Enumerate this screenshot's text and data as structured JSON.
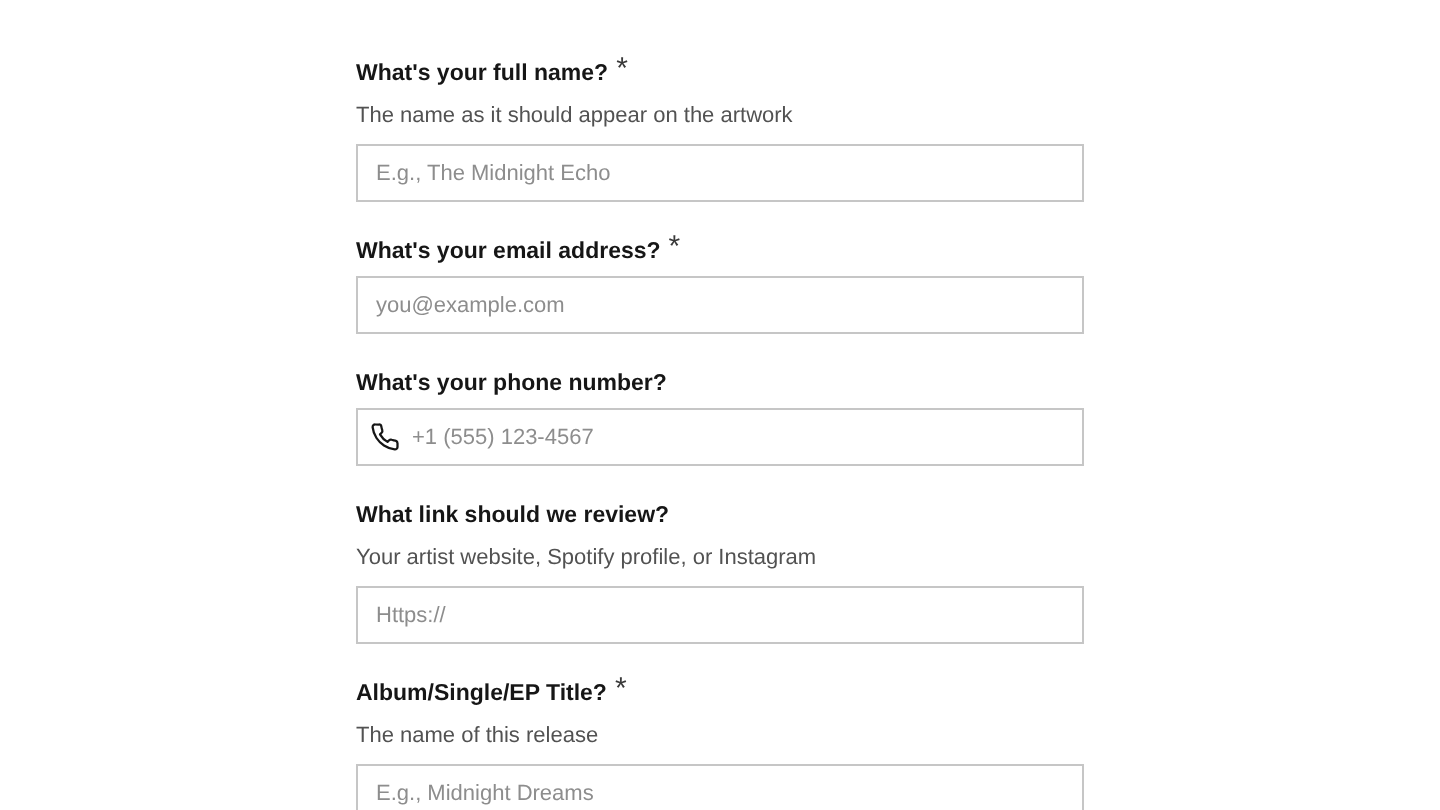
{
  "fields": [
    {
      "label": "What's your full name?",
      "required_mark": "*",
      "help": "The name as it should appear on the artwork",
      "placeholder": "E.g., The Midnight Echo"
    },
    {
      "label": "What's your email address?",
      "required_mark": "*",
      "placeholder": "you@example.com"
    },
    {
      "label": "What's your phone number?",
      "kind": "phone",
      "placeholder": "+1 (555) 123-4567"
    },
    {
      "label": "What link should we review?",
      "help": "Your artist website, Spotify profile, or Instagram",
      "placeholder": "Https://"
    },
    {
      "label": "Album/Single/EP Title?",
      "required_mark": "*",
      "help": "The name of this release",
      "placeholder": "E.g., Midnight Dreams"
    }
  ]
}
